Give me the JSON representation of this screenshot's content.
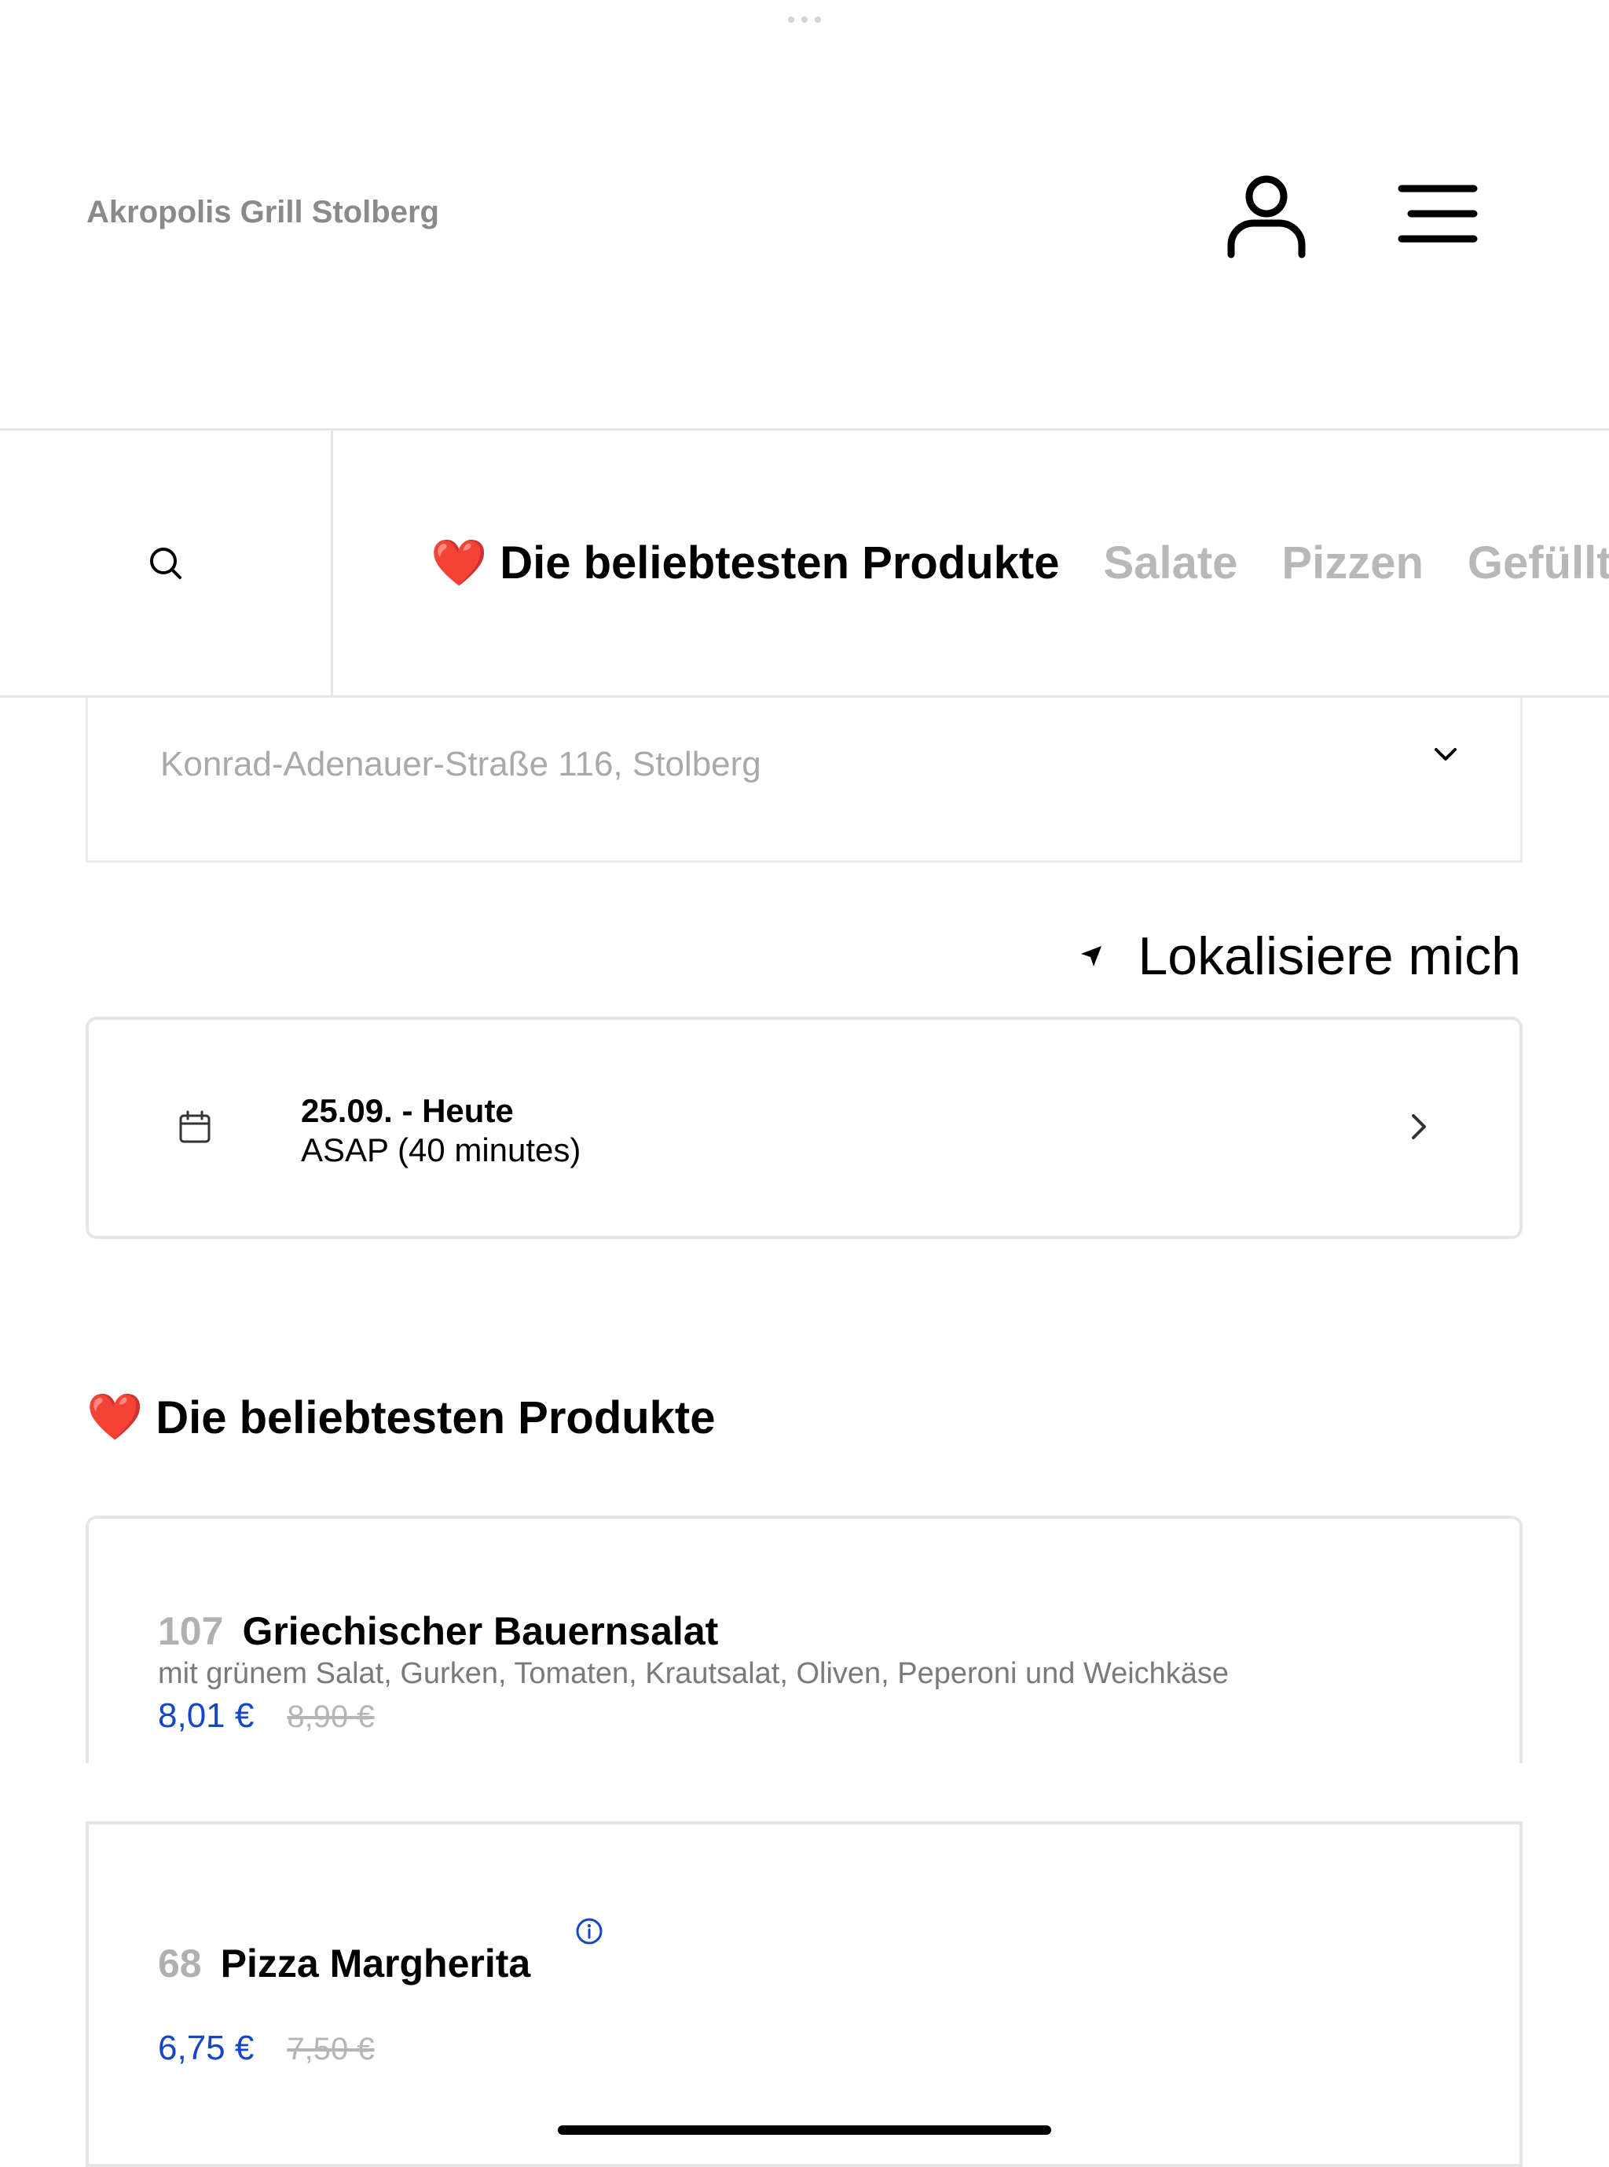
{
  "header": {
    "restaurant_name": "Akropolis Grill Stolberg"
  },
  "nav": {
    "tabs": [
      {
        "label": "Die beliebtesten Produkte",
        "active": true,
        "emoji": "❤️"
      },
      {
        "label": "Salate",
        "active": false
      },
      {
        "label": "Pizzen",
        "active": false
      },
      {
        "label": "Gefüllt",
        "active": false
      }
    ]
  },
  "address": {
    "value": "Konrad-Adenauer-Straße 116, Stolberg"
  },
  "locate": {
    "label": "Lokalisiere mich"
  },
  "delivery_time": {
    "date": "25.09. - Heute",
    "time": "ASAP (40 minutes)"
  },
  "section": {
    "emoji": "❤️",
    "title": "Die beliebtesten Produkte"
  },
  "products": [
    {
      "number": "107",
      "name": "Griechischer Bauernsalat",
      "description": "mit grünem Salat, Gurken, Tomaten, Krautsalat, Oliven, Peperoni und Weichkäse",
      "price": "8,01 €",
      "old_price": "8,90 €"
    },
    {
      "number": "68",
      "name": "Pizza Margherita",
      "price": "6,75 €",
      "old_price": "7,50 €"
    }
  ],
  "colors": {
    "accent_price": "#1546c8",
    "muted_text": "#b0b0b0",
    "border": "#e5e5e5"
  },
  "icons": {
    "search": "search-icon",
    "user": "user-icon",
    "menu": "menu-icon",
    "chevron_down": "chevron-down-icon",
    "locate": "location-arrow-icon",
    "calendar": "calendar-icon",
    "chevron_right": "chevron-right-icon",
    "info": "info-icon"
  }
}
